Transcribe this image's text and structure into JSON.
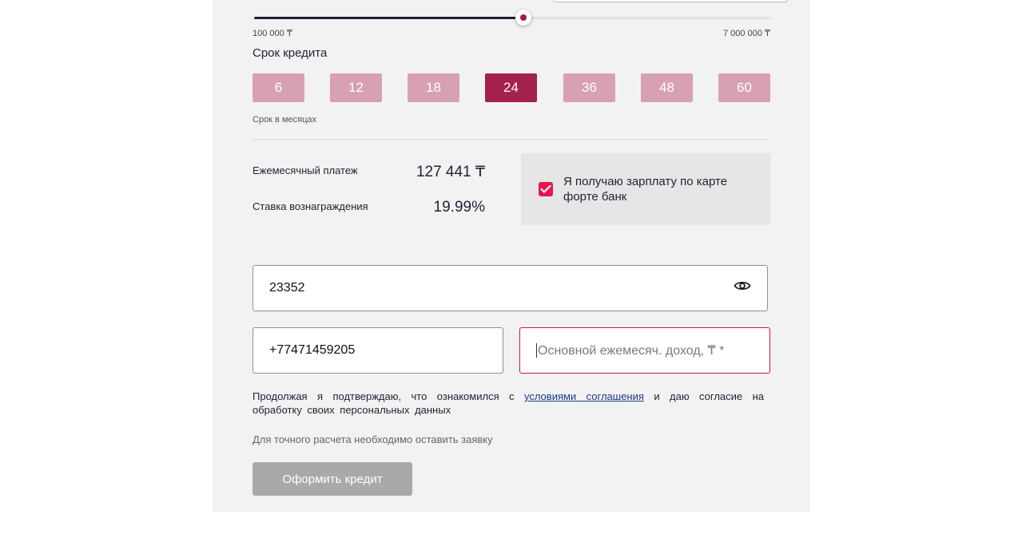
{
  "loan_amount": {
    "min_label": "100 000 ₸",
    "max_label": "7 000 000 ₸",
    "slider_fraction": 0.52
  },
  "term": {
    "title": "Срок кредита",
    "options": [
      "6",
      "12",
      "18",
      "24",
      "36",
      "48",
      "60"
    ],
    "selected": "24",
    "hint": "Срок в месяцах"
  },
  "summary": {
    "monthly_label": "Ежемесячный платеж",
    "monthly_value": "127 441 ₸",
    "rate_label": "Ставка вознаграждения",
    "rate_value": "19.99%"
  },
  "salary_card": {
    "checked": true,
    "label": "Я получаю зарплату по карте форте банк"
  },
  "form": {
    "iin_value": "23352",
    "phone_value": "+77471459205",
    "income_placeholder": "Основной ежемесяч. доход, ₸ *"
  },
  "consent": {
    "text_before": "Продолжая я подтверждаю, что ознакомился с ",
    "link_text": "условиями соглашения",
    "text_after": " и даю согласие на обработку своих персональных данных"
  },
  "note": "Для точного расчета необходимо оставить заявку",
  "submit_label": "Оформить кредит",
  "colors": {
    "accent": "#a3214d",
    "accent_light": "#d7a1b1",
    "checkbox": "#e8154e",
    "error_border": "#c71b2c",
    "link": "#1a3a8c",
    "disabled_button": "#a9a9a9"
  },
  "icons": {
    "visibility": "eye-icon",
    "checkbox": "checkmark-icon"
  }
}
